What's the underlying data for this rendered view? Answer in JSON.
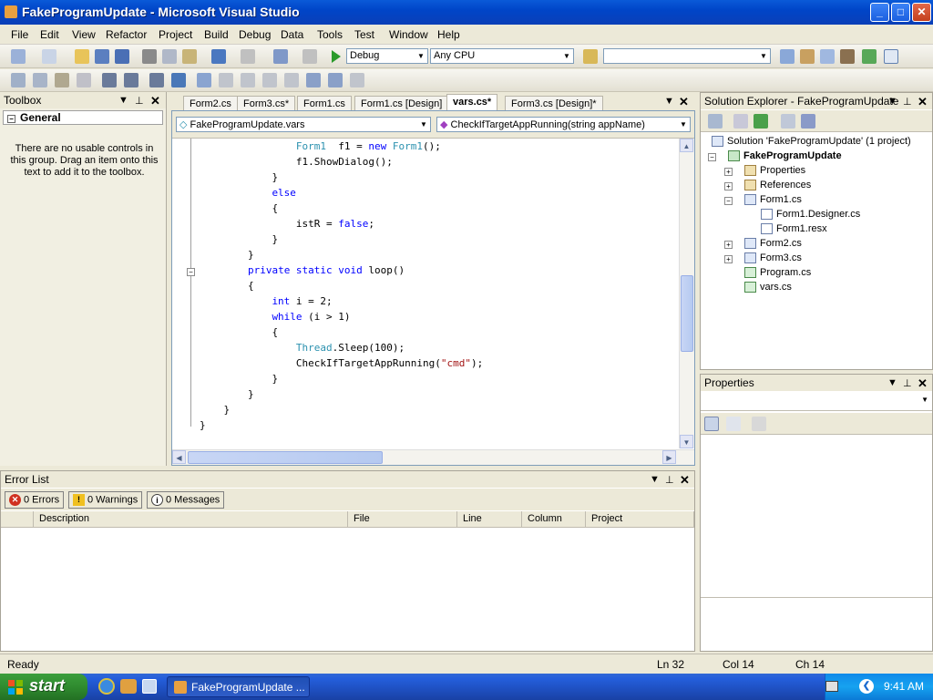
{
  "window": {
    "title": "FakeProgramUpdate - Microsoft Visual Studio",
    "buttons": {
      "minimize": "_",
      "maximize": "□",
      "close": "✕"
    }
  },
  "menu": [
    "File",
    "Edit",
    "View",
    "Refactor",
    "Project",
    "Build",
    "Debug",
    "Data",
    "Tools",
    "Test",
    "Window",
    "Help"
  ],
  "toolbar": {
    "config": "Debug",
    "platform": "Any CPU",
    "find": ""
  },
  "toolbox": {
    "title": "Toolbox",
    "group": "General",
    "empty_message": "There are no usable controls in this group. Drag an item onto this text to add it to the toolbox."
  },
  "editor": {
    "tabs": [
      "Form2.cs",
      "Form3.cs*",
      "Form1.cs",
      "Form1.cs [Design]",
      "vars.cs*",
      "Form3.cs [Design]*"
    ],
    "active_tab_index": 4,
    "class_combo": "FakeProgramUpdate.vars",
    "member_combo": "CheckIfTargetAppRunning(string appName)",
    "code_lines": [
      {
        "indent": 16,
        "tokens": [
          [
            "ty",
            "Form1"
          ],
          [
            "",
            "  f1 = "
          ],
          [
            "kw",
            "new"
          ],
          [
            "",
            ""
          ],
          [
            "ty",
            " Form1"
          ],
          [
            "",
            "();"
          ]
        ]
      },
      {
        "indent": 16,
        "tokens": [
          [
            "",
            "f1.ShowDialog();"
          ]
        ]
      },
      {
        "indent": 12,
        "tokens": [
          [
            "",
            "}"
          ]
        ]
      },
      {
        "indent": 12,
        "tokens": [
          [
            "kw",
            "else"
          ]
        ]
      },
      {
        "indent": 12,
        "tokens": [
          [
            "",
            "{"
          ]
        ]
      },
      {
        "indent": 16,
        "tokens": [
          [
            "",
            "istR = "
          ],
          [
            "kw",
            "false"
          ],
          [
            "",
            ";"
          ]
        ]
      },
      {
        "indent": 12,
        "tokens": [
          [
            "",
            "}"
          ]
        ]
      },
      {
        "indent": 8,
        "tokens": [
          [
            "",
            "}"
          ]
        ]
      },
      {
        "indent": 8,
        "tokens": [
          [
            "kw",
            "private static void"
          ],
          [
            "",
            " loop()"
          ]
        ]
      },
      {
        "indent": 8,
        "tokens": [
          [
            "",
            "{"
          ]
        ]
      },
      {
        "indent": 12,
        "tokens": [
          [
            "kw",
            "int"
          ],
          [
            "",
            " i = 2;"
          ]
        ]
      },
      {
        "indent": 12,
        "tokens": [
          [
            "kw",
            "while"
          ],
          [
            "",
            " (i > 1)"
          ]
        ]
      },
      {
        "indent": 12,
        "tokens": [
          [
            "",
            "{"
          ]
        ]
      },
      {
        "indent": 16,
        "tokens": [
          [
            "ty",
            "Thread"
          ],
          [
            "",
            ".Sleep(100);"
          ]
        ]
      },
      {
        "indent": 16,
        "tokens": [
          [
            "",
            "CheckIfTargetAppRunning("
          ],
          [
            "st",
            "\"cmd\""
          ],
          [
            "",
            ");"
          ]
        ]
      },
      {
        "indent": 12,
        "tokens": [
          [
            "",
            "}"
          ]
        ]
      },
      {
        "indent": 8,
        "tokens": [
          [
            "",
            "}"
          ]
        ]
      },
      {
        "indent": 4,
        "tokens": [
          [
            "",
            "}"
          ]
        ]
      },
      {
        "indent": 0,
        "tokens": [
          [
            "",
            "}"
          ]
        ]
      }
    ]
  },
  "solution_explorer": {
    "title": "Solution Explorer - FakeProgramUpdate",
    "solution": "Solution 'FakeProgramUpdate' (1 project)",
    "project": "FakeProgramUpdate",
    "items": [
      "Properties",
      "References",
      "Form1.cs",
      "Form1.Designer.cs",
      "Form1.resx",
      "Form2.cs",
      "Form3.cs",
      "Program.cs",
      "vars.cs"
    ]
  },
  "properties": {
    "title": "Properties"
  },
  "error_list": {
    "title": "Error List",
    "errors": "0 Errors",
    "warnings": "0 Warnings",
    "messages": "0 Messages",
    "columns": [
      "Description",
      "File",
      "Line",
      "Column",
      "Project"
    ]
  },
  "status": {
    "text": "Ready",
    "ln": "Ln 32",
    "col": "Col 14",
    "ch": "Ch 14"
  },
  "taskbar": {
    "start": "start",
    "task": "FakeProgramUpdate ...",
    "clock": "9:41 AM"
  },
  "colors": {
    "keyword": "#0000ff",
    "type": "#2b91af",
    "string": "#a31515"
  }
}
